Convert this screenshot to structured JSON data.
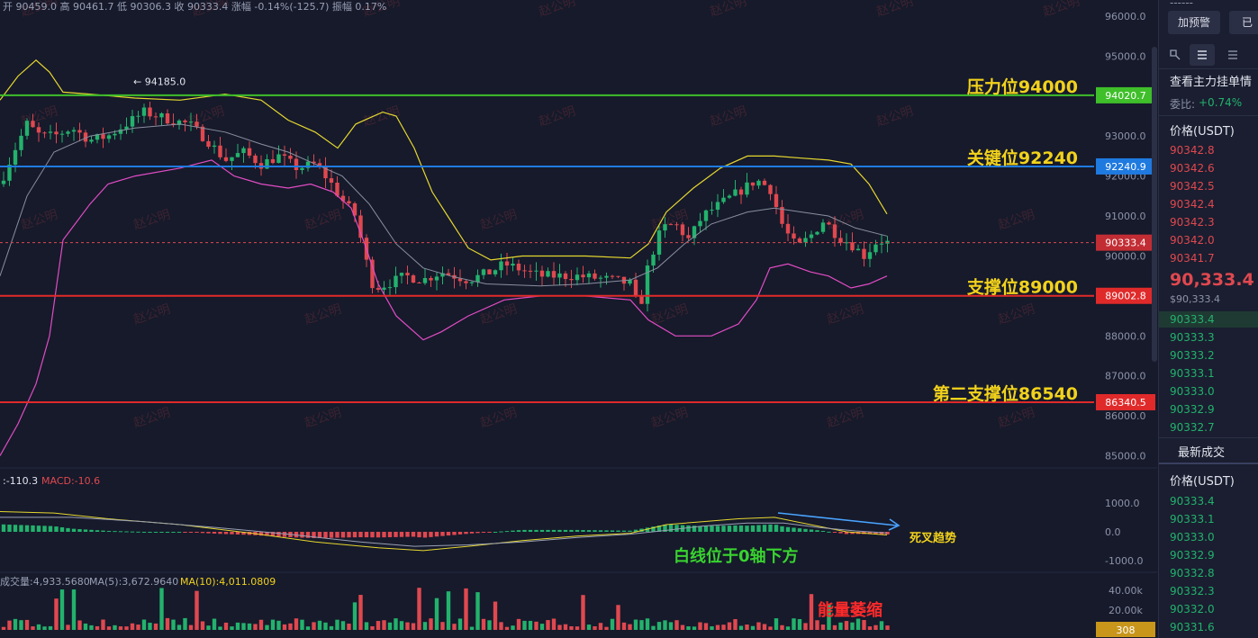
{
  "header": {
    "ohlc_text": "开 90459.0  高 90461.7  低 90306.3  收 90333.4  涨幅 -0.14%(-125.7)  振幅 0.17%"
  },
  "watermark": "赵公明",
  "colors": {
    "background": "#161a2b",
    "up": "#23b26d",
    "down": "#e0484f",
    "resistance_line": "#3fbf2a",
    "key_line": "#1f7ae0",
    "support_line": "#e02a2a",
    "boll_upper": "#e6d72e",
    "boll_lower": "#e24cc4",
    "boll_mid": "#8a8fa0",
    "annotation_yellow": "#f2d21b",
    "annotation_green": "#39d42f",
    "annotation_red": "#ff2a2a",
    "arrow_blue": "#4aa3ff"
  },
  "chart_data": [
    {
      "type": "candlestick",
      "panel": "price",
      "y_axis_ticks": [
        "96000.0",
        "95000.0",
        "94000.0",
        "93000.0",
        "92000.0",
        "91000.0",
        "90000.0",
        "89000.0",
        "88000.0",
        "87000.0",
        "86000.0",
        "85000.0"
      ],
      "ylim": [
        84800,
        96200
      ],
      "peak_marker": "← 94185.0",
      "peak_value": 94185.0,
      "last_price": 90333.4,
      "last_price_label": "90333.4",
      "levels": [
        {
          "name": "压力位94000",
          "value": 94020.7,
          "axis_label": "94020.7",
          "color_key": "resistance_line"
        },
        {
          "name": "关键位92240",
          "value": 92240.9,
          "axis_label": "92240.9",
          "color_key": "key_line"
        },
        {
          "name": "支撑位89000",
          "value": 89002.8,
          "axis_label": "89002.8",
          "color_key": "support_line"
        },
        {
          "name": "第二支撑位86540",
          "value": 86340.5,
          "axis_label": "86340.5",
          "color_key": "support_line"
        }
      ],
      "bollinger_upper": [
        [
          0,
          93900
        ],
        [
          20,
          94500
        ],
        [
          40,
          94900
        ],
        [
          55,
          94600
        ],
        [
          70,
          94100
        ],
        [
          100,
          94050
        ],
        [
          150,
          93950
        ],
        [
          200,
          93900
        ],
        [
          250,
          94050
        ],
        [
          290,
          93900
        ],
        [
          320,
          93400
        ],
        [
          350,
          93100
        ],
        [
          375,
          92700
        ],
        [
          395,
          93300
        ],
        [
          410,
          93450
        ],
        [
          425,
          93600
        ],
        [
          440,
          93500
        ],
        [
          460,
          92700
        ],
        [
          480,
          91600
        ],
        [
          500,
          90900
        ],
        [
          520,
          90200
        ],
        [
          545,
          89900
        ],
        [
          580,
          90000
        ],
        [
          650,
          90000
        ],
        [
          700,
          89950
        ],
        [
          720,
          90300
        ],
        [
          740,
          91100
        ],
        [
          770,
          91700
        ],
        [
          800,
          92200
        ],
        [
          830,
          92500
        ],
        [
          860,
          92500
        ],
        [
          890,
          92450
        ],
        [
          920,
          92400
        ],
        [
          945,
          92300
        ],
        [
          965,
          91800
        ],
        [
          985,
          91050
        ]
      ],
      "bollinger_lower": [
        [
          0,
          85000
        ],
        [
          20,
          85800
        ],
        [
          40,
          86800
        ],
        [
          55,
          88000
        ],
        [
          70,
          90400
        ],
        [
          100,
          91300
        ],
        [
          120,
          91800
        ],
        [
          150,
          92000
        ],
        [
          200,
          92200
        ],
        [
          235,
          92400
        ],
        [
          260,
          92000
        ],
        [
          290,
          91800
        ],
        [
          320,
          91700
        ],
        [
          345,
          91800
        ],
        [
          370,
          91600
        ],
        [
          390,
          91200
        ],
        [
          405,
          90300
        ],
        [
          420,
          89300
        ],
        [
          440,
          88500
        ],
        [
          470,
          87900
        ],
        [
          490,
          88100
        ],
        [
          520,
          88500
        ],
        [
          560,
          88900
        ],
        [
          600,
          89000
        ],
        [
          650,
          89000
        ],
        [
          700,
          88900
        ],
        [
          720,
          88400
        ],
        [
          750,
          88000
        ],
        [
          790,
          88000
        ],
        [
          820,
          88300
        ],
        [
          840,
          88900
        ],
        [
          855,
          89700
        ],
        [
          875,
          89800
        ],
        [
          900,
          89600
        ],
        [
          920,
          89500
        ],
        [
          945,
          89200
        ],
        [
          965,
          89300
        ],
        [
          985,
          89500
        ]
      ],
      "bollinger_mid": [
        [
          0,
          89500
        ],
        [
          30,
          91500
        ],
        [
          60,
          92600
        ],
        [
          100,
          93000
        ],
        [
          150,
          93200
        ],
        [
          200,
          93300
        ],
        [
          250,
          93100
        ],
        [
          290,
          92800
        ],
        [
          320,
          92600
        ],
        [
          350,
          92300
        ],
        [
          380,
          92000
        ],
        [
          410,
          91300
        ],
        [
          440,
          90300
        ],
        [
          470,
          89700
        ],
        [
          500,
          89500
        ],
        [
          540,
          89300
        ],
        [
          600,
          89250
        ],
        [
          650,
          89300
        ],
        [
          700,
          89400
        ],
        [
          730,
          89700
        ],
        [
          760,
          90300
        ],
        [
          790,
          90800
        ],
        [
          830,
          91100
        ],
        [
          860,
          91200
        ],
        [
          890,
          91100
        ],
        [
          920,
          91000
        ],
        [
          950,
          90700
        ],
        [
          985,
          90500
        ]
      ]
    },
    {
      "type": "bar",
      "panel": "macd",
      "label_dif": ":-110.3",
      "label_macd": "MACD:-10.6",
      "y_axis_ticks": [
        "1000.0",
        "0.0",
        "-1000.0"
      ],
      "ylim": [
        -1300,
        1300
      ],
      "dif_line": [
        [
          0,
          700
        ],
        [
          60,
          650
        ],
        [
          120,
          450
        ],
        [
          200,
          250
        ],
        [
          280,
          -50
        ],
        [
          350,
          -350
        ],
        [
          420,
          -550
        ],
        [
          470,
          -650
        ],
        [
          520,
          -500
        ],
        [
          580,
          -300
        ],
        [
          640,
          -150
        ],
        [
          700,
          -50
        ],
        [
          740,
          250
        ],
        [
          780,
          350
        ],
        [
          820,
          450
        ],
        [
          860,
          500
        ],
        [
          900,
          250
        ],
        [
          940,
          0
        ],
        [
          985,
          -110
        ]
      ],
      "dea_line": [
        [
          0,
          500
        ],
        [
          80,
          500
        ],
        [
          160,
          350
        ],
        [
          240,
          150
        ],
        [
          320,
          -80
        ],
        [
          400,
          -350
        ],
        [
          460,
          -500
        ],
        [
          520,
          -450
        ],
        [
          580,
          -350
        ],
        [
          640,
          -200
        ],
        [
          700,
          -80
        ],
        [
          740,
          50
        ],
        [
          780,
          200
        ],
        [
          830,
          300
        ],
        [
          870,
          300
        ],
        [
          910,
          150
        ],
        [
          950,
          30
        ],
        [
          985,
          -40
        ]
      ]
    },
    {
      "type": "bar",
      "panel": "volume",
      "label_vol": "成交量:4,933.5680",
      "label_ma5": "MA(5):3,672.9640",
      "label_ma10": "MA(10):4,011.0809",
      "y_axis_ticks": [
        "40.00k",
        "20.00k"
      ],
      "ylim": [
        0,
        55000
      ],
      "last_value_label": "308"
    }
  ],
  "annotations": {
    "resistance": "压力位94000",
    "key": "关键位92240",
    "support1": "支撑位89000",
    "support2": "第二支撑位86540",
    "macd_note": "白线位于0轴下方",
    "death_cross": "死叉趋势",
    "volume_note": "能量萎缩"
  },
  "sidebar": {
    "dashes": "------",
    "btn_alert": "加预警",
    "btn_other": "已",
    "orderbook_title": "查看主力挂单情",
    "ratio_label": "委比:",
    "ratio_value": "+0.74%",
    "price_header": "价格(USDT)",
    "asks": [
      "90342.8",
      "90342.6",
      "90342.5",
      "90342.4",
      "90342.3",
      "90342.0",
      "90341.7"
    ],
    "mid_price": "90,333.4",
    "mid_price_usd": "$90,333.4",
    "bids": [
      "90333.4",
      "90333.3",
      "90333.2",
      "90333.1",
      "90333.0",
      "90332.9",
      "90332.7"
    ],
    "trades_title": "最新成交",
    "trades_header": "价格(USDT)",
    "trades": [
      "90333.4",
      "90333.1",
      "90333.0",
      "90332.9",
      "90332.8",
      "90332.3",
      "90332.0",
      "90331.6"
    ]
  }
}
